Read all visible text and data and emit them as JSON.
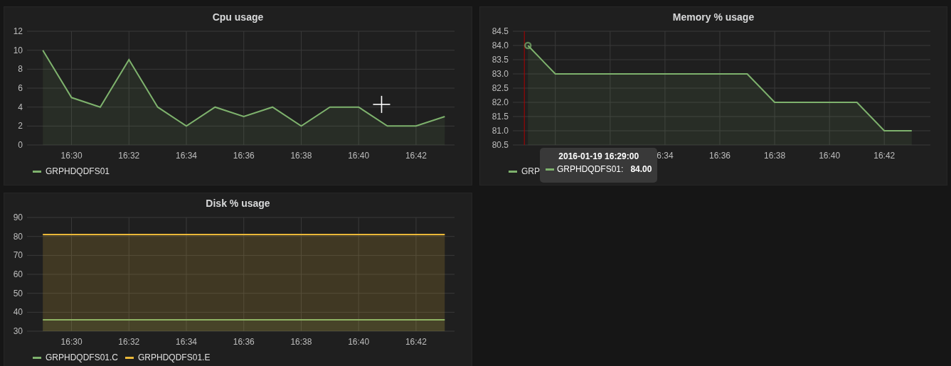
{
  "panels": [
    {
      "title": "Cpu usage",
      "cursor_visible": true,
      "chart_data": {
        "type": "area",
        "categories": [
          null,
          "16:30",
          null,
          "16:32",
          null,
          "16:34",
          null,
          "16:36",
          null,
          "16:38",
          null,
          "16:40",
          null,
          "16:42",
          null
        ],
        "series": [
          {
            "name": "GRPHDQDFS01",
            "color": "#7eb26d",
            "values": [
              10,
              5,
              4,
              9,
              4,
              2,
              4,
              3,
              4,
              2,
              4,
              4,
              2,
              2,
              3
            ]
          }
        ],
        "ylim": [
          0,
          12
        ],
        "yticks": [
          0,
          2,
          4,
          6,
          8,
          10,
          12
        ],
        "grid": true
      }
    },
    {
      "title": "Memory % usage",
      "chart_data": {
        "type": "area",
        "categories": [
          null,
          null,
          null,
          null,
          null,
          "6:34",
          null,
          "16:36",
          null,
          "16:38",
          null,
          "16:40",
          null,
          "16:42",
          null
        ],
        "series": [
          {
            "name": "GRPHDQDFS01",
            "color": "#7eb26d",
            "values": [
              84,
              83,
              83,
              83,
              83,
              83,
              83,
              83,
              83,
              82,
              82,
              82,
              82,
              81,
              81
            ]
          }
        ],
        "ylim": [
          80.5,
          84.5
        ],
        "yticks": [
          {
            "value": 80.5,
            "label": "80.5"
          },
          {
            "value": 81,
            "label": "81.0"
          },
          {
            "value": 81.5,
            "label": "81.5"
          },
          {
            "value": 82,
            "label": "82.0"
          },
          {
            "value": 82.5,
            "label": "82.5"
          },
          {
            "value": 83,
            "label": "83.0"
          },
          {
            "value": 83.5,
            "label": "83.5"
          },
          {
            "value": 84,
            "label": "84.0"
          },
          {
            "value": 84.5,
            "label": "84.5"
          }
        ],
        "grid": true
      },
      "legend": [
        {
          "label": "GRP"
        }
      ],
      "tooltip": {
        "title": "2016-01-19 16:29:00",
        "rows": [
          {
            "series_suffix": ":",
            "value": "84.00"
          }
        ]
      }
    },
    {
      "title": "Disk % usage",
      "chart_data": {
        "type": "area",
        "categories": [
          null,
          "16:30",
          null,
          "16:32",
          null,
          "16:34",
          null,
          "16:36",
          null,
          "16:38",
          null,
          "16:40",
          null,
          "16:42",
          null
        ],
        "series": [
          {
            "name": "GRPHDQDFS01.C",
            "color": "#7eb26d",
            "values": [
              36,
              36,
              36,
              36,
              36,
              36,
              36,
              36,
              36,
              36,
              36,
              36,
              36,
              36,
              36
            ]
          },
          {
            "name": "GRPHDQDFS01.E",
            "color": "#eab839",
            "values": [
              81,
              81,
              81,
              81,
              81,
              81,
              81,
              81,
              81,
              81,
              81,
              81,
              81,
              81,
              81
            ]
          }
        ],
        "ylim": [
          30,
          90
        ],
        "yticks": [
          30,
          40,
          50,
          60,
          70,
          80,
          90
        ],
        "grid": true
      }
    }
  ]
}
